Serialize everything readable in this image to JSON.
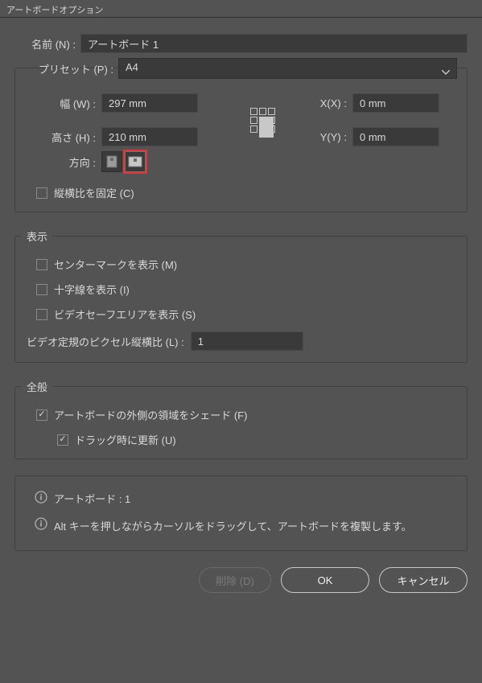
{
  "title": "アートボードオプション",
  "name": {
    "label": "名前 (N) :",
    "value": "アートボード 1"
  },
  "preset": {
    "label": "プリセット (P) :",
    "value": "A4"
  },
  "dims": {
    "width_label": "幅 (W) :",
    "width_value": "297 mm",
    "height_label": "高さ (H) :",
    "height_value": "210 mm",
    "x_label": "X(X) :",
    "x_value": "0 mm",
    "y_label": "Y(Y) :",
    "y_value": "0 mm",
    "orientation_label": "方向 :"
  },
  "lock_aspect": {
    "label": "縦横比を固定 (C)",
    "checked": false
  },
  "display": {
    "legend": "表示",
    "center_mark": {
      "label": "センターマークを表示 (M)",
      "checked": false
    },
    "crosshair": {
      "label": "十字線を表示 (I)",
      "checked": false
    },
    "video_safe": {
      "label": "ビデオセーフエリアを表示 (S)",
      "checked": false
    },
    "pixel_ratio_label": "ビデオ定規のピクセル縦横比 (L) :",
    "pixel_ratio_value": "1"
  },
  "general": {
    "legend": "全般",
    "shade_outside": {
      "label": "アートボードの外側の領域をシェード (F)",
      "checked": true
    },
    "drag_update": {
      "label": "ドラッグ時に更新 (U)",
      "checked": true
    }
  },
  "info": {
    "count_label": "アートボード : 1",
    "hint": "Alt キーを押しながらカーソルをドラッグして、アートボードを複製します。"
  },
  "buttons": {
    "delete": "削除 (D)",
    "ok": "OK",
    "cancel": "キャンセル"
  }
}
